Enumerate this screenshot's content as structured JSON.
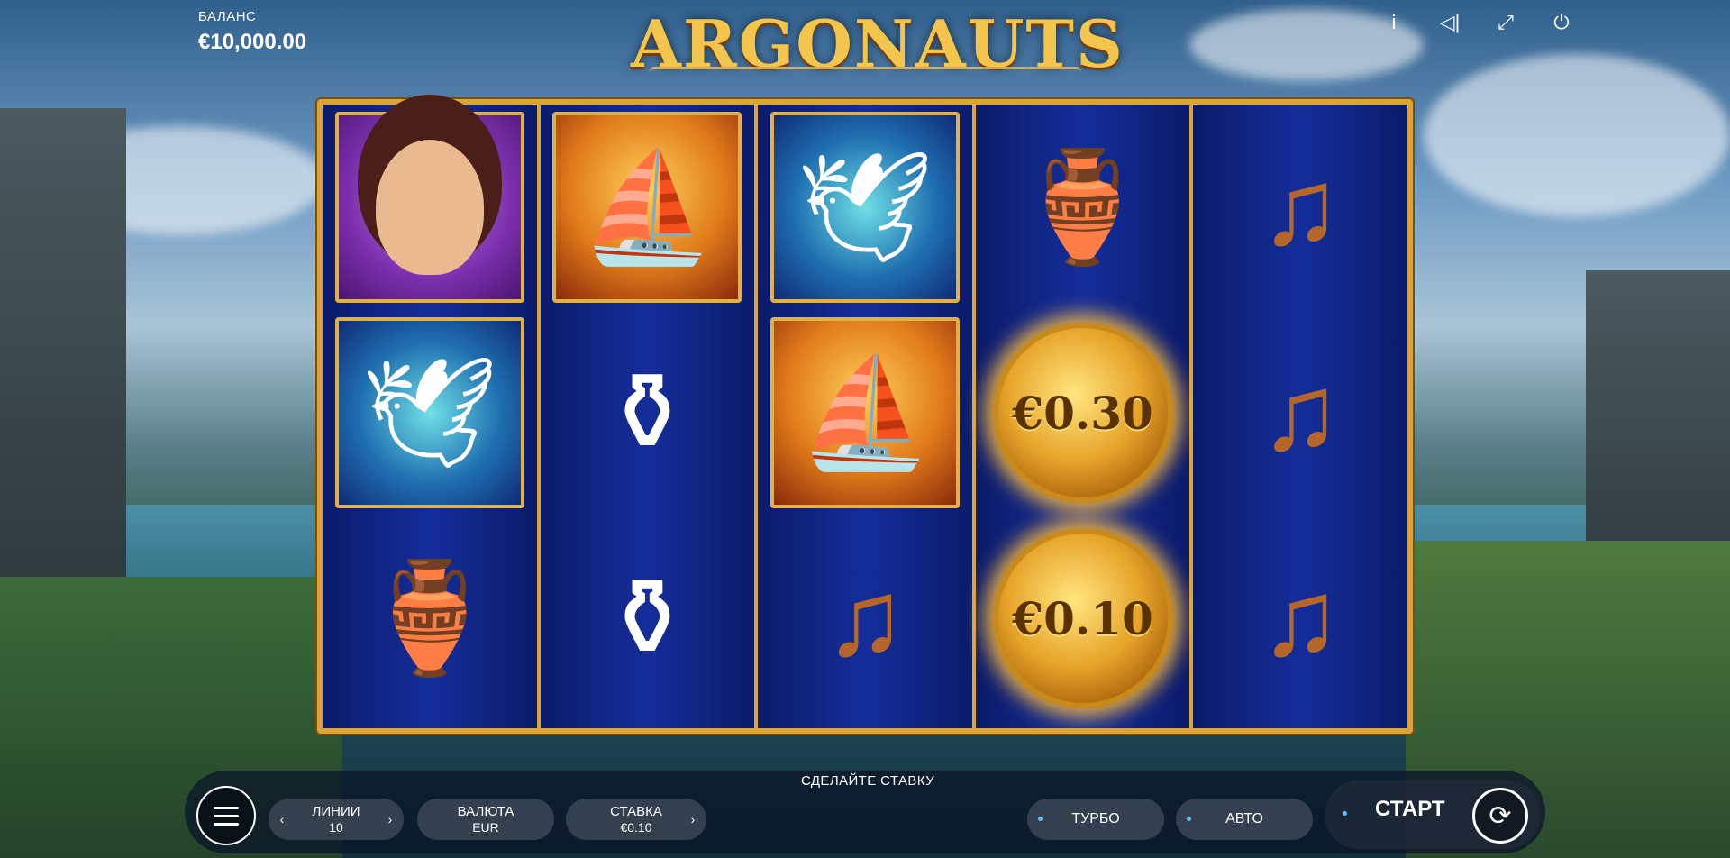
{
  "balance": {
    "label": "БАЛАНС",
    "value": "€10,000.00"
  },
  "logo": "ARGONAUTS",
  "top_icons": [
    "info-icon",
    "sound-icon",
    "fullscreen-icon",
    "power-icon"
  ],
  "reels": [
    [
      "maiden",
      "dove",
      "cup"
    ],
    [
      "ship",
      "potion",
      "potion"
    ],
    [
      "dove",
      "ship",
      "lyre"
    ],
    [
      "cup",
      "coin",
      "coin"
    ],
    [
      "lyre",
      "lyre",
      "lyre"
    ]
  ],
  "coins": {
    "top": "€0.30",
    "bottom": "€0.10"
  },
  "prompt": "СДЕЛАЙТЕ СТАВКУ",
  "controls": {
    "lines": {
      "label": "ЛИНИИ",
      "value": "10"
    },
    "currency": {
      "label": "ВАЛЮТА",
      "value": "EUR"
    },
    "bet": {
      "label": "СТАВКА",
      "value": "€0.10"
    },
    "turbo": "ТУРБО",
    "auto": "АВТО",
    "start": "СТАРТ"
  },
  "colors": {
    "frame_gold": "#d9a43a",
    "reel_blue": "#142d9a",
    "coin_gold": "#e7a52a"
  }
}
